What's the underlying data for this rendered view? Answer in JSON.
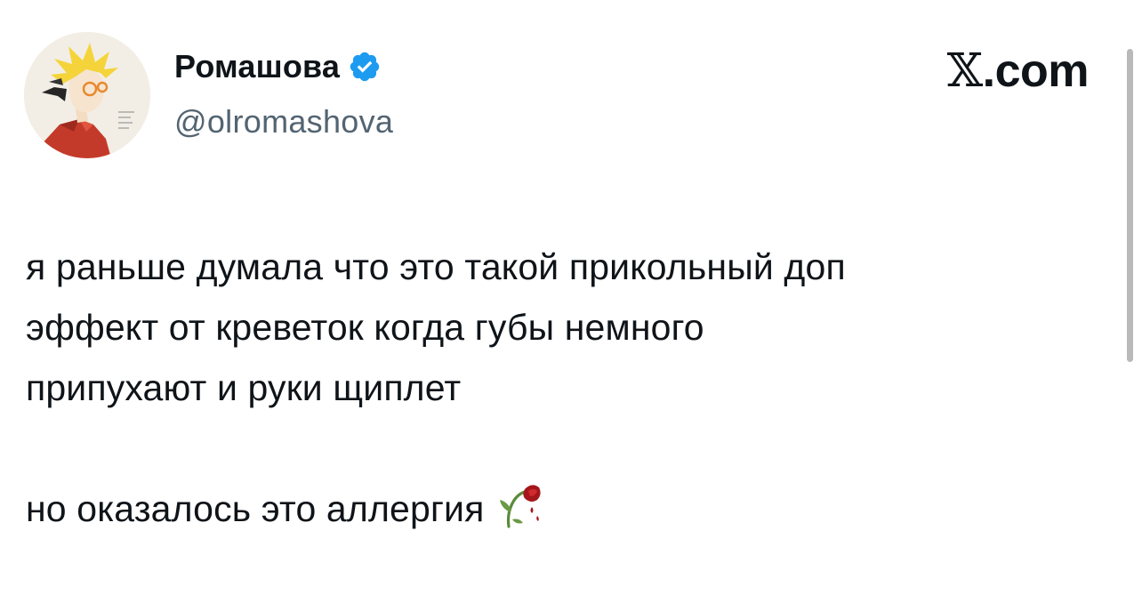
{
  "author": {
    "display_name": "Ромашова",
    "handle": "@olromashova",
    "verified": true,
    "avatar_icon": "anime-character-avatar-icon",
    "verified_icon": "verified-badge-icon",
    "verified_color": "#1d9bf0"
  },
  "brand": {
    "glyph": "𝕏",
    "suffix": ".com"
  },
  "tweet": {
    "paragraph_1": "я раньше думала что это такой прикольный доп\nэффект от креветок когда губы немного\nприпухают и руки щиплет",
    "paragraph_2": "но оказалось это аллергия",
    "emoji_icon": "wilted-flower-icon"
  },
  "colors": {
    "text": "#0f1419",
    "secondary_text": "#536471",
    "background": "#ffffff"
  }
}
